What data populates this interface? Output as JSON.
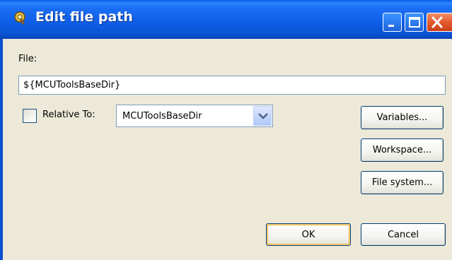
{
  "window": {
    "title": "Edit file path",
    "icon": "hammer-gear-icon"
  },
  "file": {
    "label": "File:",
    "value": "${MCUToolsBaseDir}"
  },
  "relative": {
    "checked": false,
    "label": "Relative To:",
    "selected": "MCUToolsBaseDir"
  },
  "buttons": {
    "variables": "Variables...",
    "workspace": "Workspace...",
    "file_system": "File system...",
    "ok": "OK",
    "cancel": "Cancel"
  },
  "colors": {
    "titlebar": "#0b5ae0",
    "dialog_bg": "#ece9d8",
    "close_button": "#e25a2c"
  }
}
